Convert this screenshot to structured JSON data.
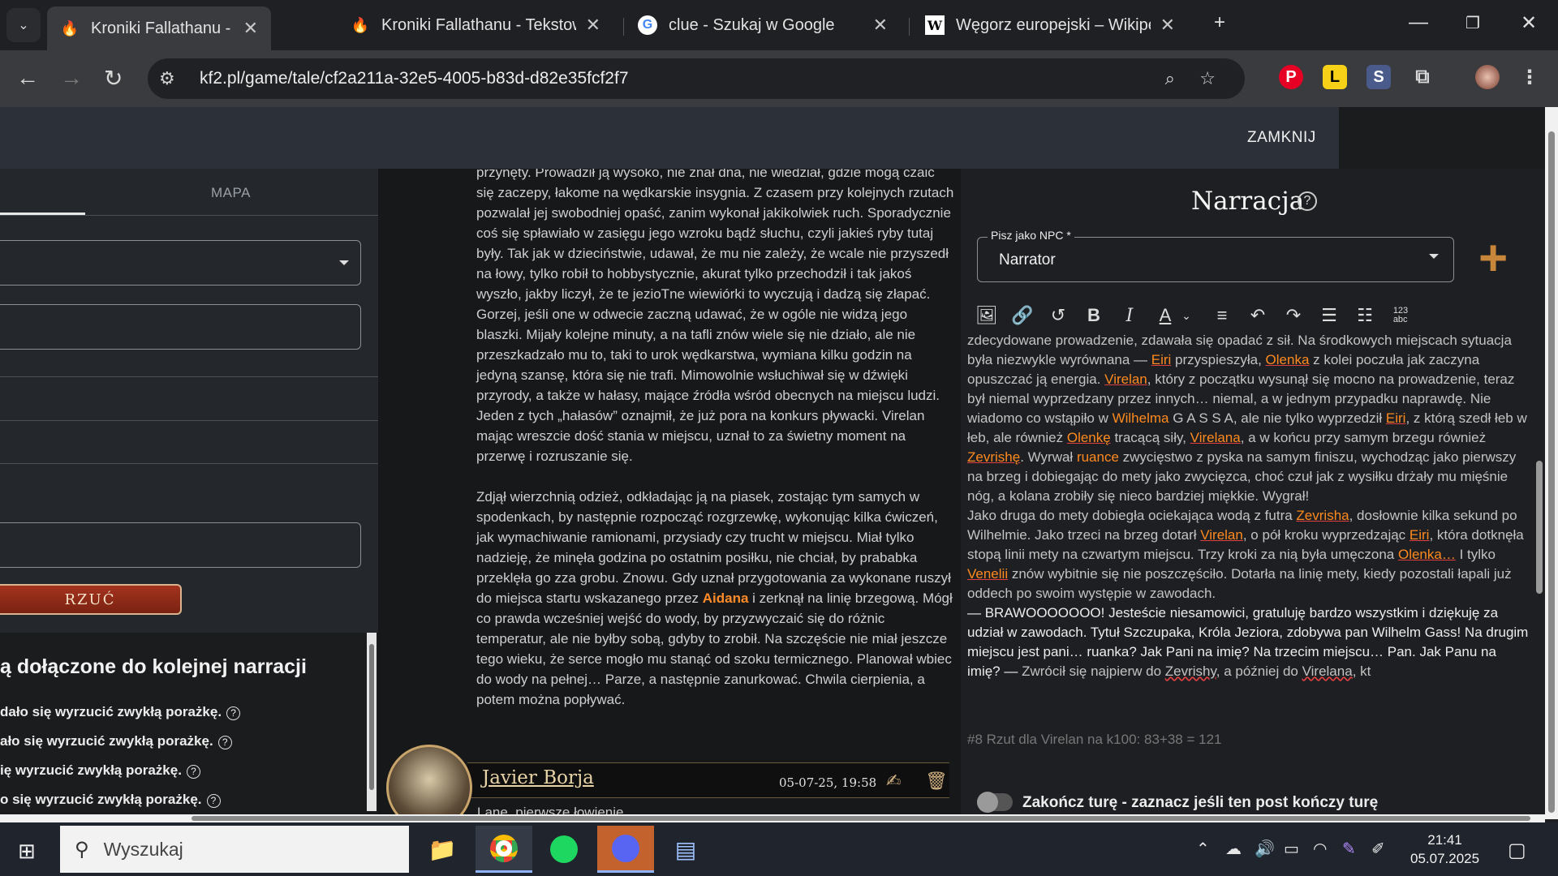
{
  "browser": {
    "tabs": [
      {
        "title": "Kroniki Fallathanu - Tekstowa G",
        "icon": "flame-icon",
        "active": true
      },
      {
        "title": "Kroniki Fallathanu - Tekstowa G",
        "icon": "flame-icon",
        "active": false
      },
      {
        "title": "clue - Szukaj w Google",
        "icon": "google-icon",
        "active": false
      },
      {
        "title": "Węgorz europejski – Wikipedia,",
        "icon": "wikipedia-icon",
        "active": false
      }
    ],
    "url": "kf2.pl/game/tale/cf2a211a-32e5-4005-b83d-d82e35fcf2f7"
  },
  "app": {
    "close_label": "ZAMKNIJ",
    "left_panel": {
      "map_tab": "MAPA",
      "roll_button": "RZUĆ",
      "joined_heading": "ą dołączone do kolejnej narracji",
      "rules": [
        "dało się wyrzucić zwykłą porażkę.",
        "ało się wyrzucić zwykłą porażkę.",
        "ię wyrzucić zwykłą porażkę.",
        "o się wyrzucić zwykłą porażkę."
      ]
    },
    "story": {
      "p1": "przynęty. Prowadził ją wysoko, nie znał dna, nie wiedział, gdzie mogą czaić się zaczepy, łakome na wędkarskie insygnia. Z czasem przy kolejnych rzutach pozwalał jej swobodniej opaść, zanim wykonał jakikolwiek ruch. Sporadycznie coś się spławiało w zasięgu jego wzroku bądź słuchu, czyli jakieś ryby tutaj były. Tak jak w dzieciństwie, udawał, że mu nie zależy, że wcale nie przyszedł na łowy, tylko robił to hobbystycznie, akurat tylko przechodził i tak jakoś wyszło, jakby liczył, że te jezioTne wiewiórki to wyczują i dadzą się złapać. Gorzej, jeśli one w odwecie zaczną udawać, że w ogóle nie widzą jego blaszki. Mijały kolejne minuty, a na tafli znów wiele się nie działo, ale nie przeszkadzało mu to, taki to urok wędkarstwa, wymiana kilku godzin na jedyną szansę, która się nie trafi. Mimowolnie wsłuchiwał się w dźwięki przyrody, a także w hałasy, mające źródła wśród obecnych na miejscu ludzi. Jeden z tych „hałasów” oznajmił, że już pora na konkurs pływacki. Virelan mając wreszcie dość stania w miejscu, uznał to za świetny moment na przerwę i rozruszanie się.",
      "p2a": "Zdjął wierzchnią odzież, odkładając ją na piasek, zostając tym samych w spodenkach, by następnie rozpocząć rozgrzewkę, wykonując kilka ćwiczeń, jak wymachiwanie ramionami, przysiady czy trucht w miejscu. Miał tylko nadzieję, że minęła godzina po ostatnim posiłku, nie chciał, by prababka przeklęła go zza grobu. Znowu. Gdy uznał przygotowania za wykonane ruszył do miejsca startu wskazanego przez ",
      "p2_npc": "Aidana",
      "p2b": " i zerknął na linię brzegową. Mógł co prawda wcześniej wejść do wody, by przyzwyczaić się do różnic temperatur, ale nie byłby sobą, gdyby to zrobił. Na szczęście nie miał jeszcze tego wieku, że serce mogło mu stanąć od szoku termicznego. Planował wbiec do wody na pełnej… Parze, a następnie zanurkować. Chwila cierpienia, a potem można popływać.",
      "post_author": "Javier Borja",
      "post_date": "05-07-25, 19:58",
      "post_subtitle": "Lane, pierwsze łowienie"
    },
    "narration": {
      "title": "Narracja",
      "npc_label": "Pisz jako NPC *",
      "npc_value": "Narrator",
      "editor_lines": {
        "a1": "zdecydowane prowadzenie, zdawała się opadać z sił. Na środkowych miejscach sytuacja była niezwykle wyrównana — ",
        "eiri": "Eiri",
        "a2": " przyspieszyła, ",
        "olenka": "Olenka",
        "a3": " z kolei poczuła jak zaczyna opuszczać ją energia. ",
        "virelan": "Virelan",
        "a4": ", który z początku wysunął się mocno na prowadzenie, teraz był niemal wyprzedzany przez innych… niemal, a w jednym przypadku naprawdę. Nie wiadomo co wstąpiło w ",
        "wilhelma": "Wilhelma",
        "a5": " G A S S A, ale nie tylko wyprzedził ",
        "a6": ", z którą szedł łeb w łeb, ale również ",
        "olenke": "Olenkę",
        "a7": " tracącą siły, ",
        "virelana": "Virelana",
        "a8": ", a w końcu przy samym brzegu również ",
        "zevrishe": "Zevrishę",
        "a9": ". Wyrwał ",
        "ruance": "ruance",
        "a10": " zwycięstwo z pyska na samym finiszu, wychodząc jako pierwszy na brzeg i dobiegając do mety jako zwycięzca, choć czuł jak z wysiłku drżały mu mięśnie nóg, a kolana zrobiły się nieco bardziej miękkie. Wygrał!",
        "b1": "Jako druga do mety dobiegła ociekająca wodą z futra ",
        "zevrisha": "Zevrisha",
        "b2": ", dosłownie kilka sekund po Wilhelmie. Jako trzeci na brzeg dotarł ",
        "b3": ", o pół kroku wyprzedzając ",
        "b4": ", która dotknęła stopą linii mety na czwartym miejscu. Trzy kroki za nią była umęczona ",
        "olenka2": "Olenka…",
        "b5": " I tylko ",
        "venelii": "Venelii",
        "b6": " znów wybitnie się nie poszczęściło. Dotarła na linię mety, kiedy pozostali łapali już oddech po swoim występie w zawodach.",
        "c1": "— BRAWOOOOOOO! Jesteście niesamowici, gratuluję bardzo wszystkim i dziękuję za udział w zawodach. Tytuł Szczupaka, Króla Jeziora, zdobywa pan Wilhelm Gass! Na drugim miejscu jest pani… ruanka? Jak Pani na imię? Na trzecim miejscu… Pan. Jak Panu na imię? — ",
        "c2": "Zwrócił się najpierw do ",
        "zevrishy": "Zevrishy",
        "c3": ", a później do ",
        "virelana2": "Virelana",
        "c4": ", kt"
      },
      "bottom_hint": "#8 Rzut dla Virelan na k100: 83+38 = 121",
      "end_turn": "Zakończ turę - zaznacz jeśli ten post kończy turę"
    }
  },
  "taskbar": {
    "search_placeholder": "Wyszukaj",
    "time": "21:41",
    "date": "05.07.2025"
  }
}
